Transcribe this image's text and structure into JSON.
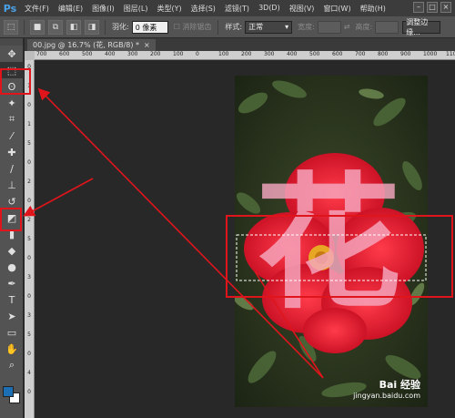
{
  "app": {
    "logo": "Ps"
  },
  "menu": [
    "文件(F)",
    "编辑(E)",
    "图像(I)",
    "图层(L)",
    "类型(Y)",
    "选择(S)",
    "滤镜(T)",
    "3D(D)",
    "视图(V)",
    "窗口(W)",
    "帮助(H)"
  ],
  "window_buttons": [
    "–",
    "□",
    "×"
  ],
  "options": {
    "feather_label": "羽化:",
    "feather_value": "0 像素",
    "antialias_label": "消除锯齿",
    "style_label": "样式:",
    "style_value": "正常",
    "width_label": "宽度:",
    "height_label": "高度:",
    "refine_button": "调整边缘..."
  },
  "document_tab": {
    "title": "00.jpg @ 16.7% (花, RGB/8) *",
    "close": "×"
  },
  "ruler_h_labels": [
    "700",
    "600",
    "500",
    "400",
    "300",
    "200",
    "100",
    "0",
    "100",
    "200",
    "300",
    "400",
    "500",
    "600",
    "700",
    "800",
    "900",
    "1000",
    "1100"
  ],
  "ruler_v_labels": [
    "0",
    "1",
    "0",
    "1",
    "5",
    "0",
    "2",
    "0",
    "2",
    "5",
    "0",
    "3",
    "0",
    "3",
    "5",
    "0",
    "4",
    "0"
  ],
  "photo": {
    "text_overlay": "花"
  },
  "watermark": {
    "brand": "Bai 经验",
    "url": "jingyan.baidu.com"
  },
  "colors": {
    "accent_red": "#e0151c",
    "flower_red": "#e8122a",
    "overlay_pink": "#f6a8c0",
    "ps_blue": "#4aa2e8"
  },
  "tools": [
    "move-icon",
    "marquee-icon",
    "lasso-icon",
    "magic-wand-icon",
    "crop-icon",
    "eyedropper-icon",
    "healing-icon",
    "brush-icon",
    "stamp-icon",
    "history-brush-icon",
    "eraser-icon",
    "gradient-icon",
    "blur-icon",
    "dodge-icon",
    "pen-icon",
    "type-icon",
    "path-select-icon",
    "shape-icon",
    "hand-icon",
    "zoom-icon"
  ]
}
